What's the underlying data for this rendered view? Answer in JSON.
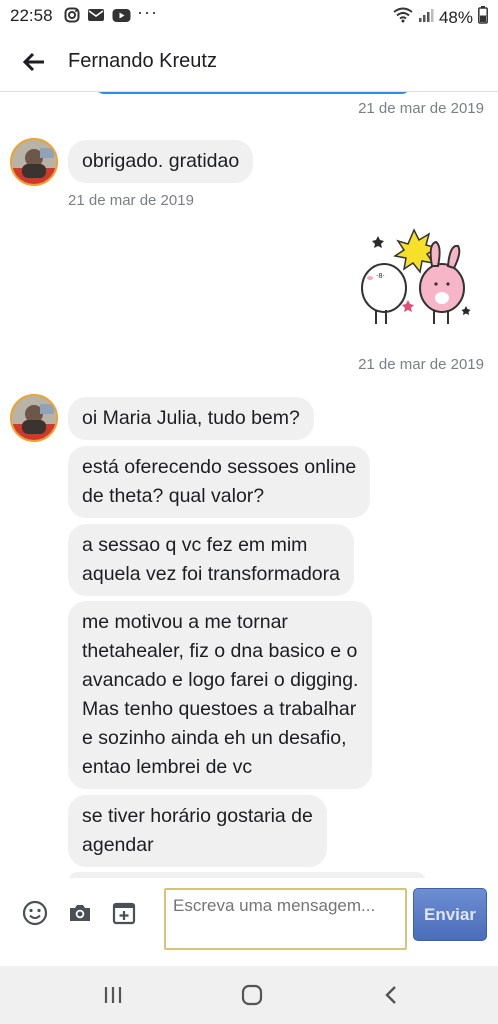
{
  "status_bar": {
    "time": "22:58",
    "battery": "48%",
    "more": "···",
    "icons": [
      "instagram-icon",
      "mail-icon",
      "youtube-icon",
      "wifi-icon",
      "signal-icon",
      "battery-icon"
    ]
  },
  "header": {
    "title": "Fernando Kreutz",
    "back_icon": "arrow-left-icon"
  },
  "messages": {
    "ts1": "21 de mar de 2019",
    "m1": "obrigado. gratidao",
    "ts2": "21 de mar de 2019",
    "ts3": "21 de mar de 2019",
    "m2": "oi Maria Julia, tudo bem?",
    "m3_line1": "está oferecendo sessoes online",
    "m3_line2": "de theta? qual valor?",
    "m4_line1": "a sessao q vc fez em mim",
    "m4_line2": "aquela vez foi transformadora",
    "m5_line1": "me motivou a me tornar",
    "m5_line2": "thetahealer, fiz o dna basico e o",
    "m5_line3": "avancado e logo farei o digging.",
    "m5_line4": "Mas tenho questoes a trabalhar",
    "m5_line5": "e sozinho ainda eh un desafio,",
    "m5_line6": "entao lembrei de vc",
    "m6_line1": "se tiver horário gostaria de",
    "m6_line2": "agendar"
  },
  "composer": {
    "placeholder": "Escreva uma mensagem...",
    "send_label": "Enviar",
    "icons": [
      "emoji-icon",
      "camera-icon",
      "add-sticker-icon"
    ]
  },
  "nav": {
    "icons": [
      "recent-apps-icon",
      "home-icon",
      "back-icon"
    ]
  },
  "colors": {
    "bubble": "#f0f0f0",
    "send_button": "#4b6dba",
    "input_border": "#d8c37a",
    "timestamp": "#7a7f86"
  }
}
